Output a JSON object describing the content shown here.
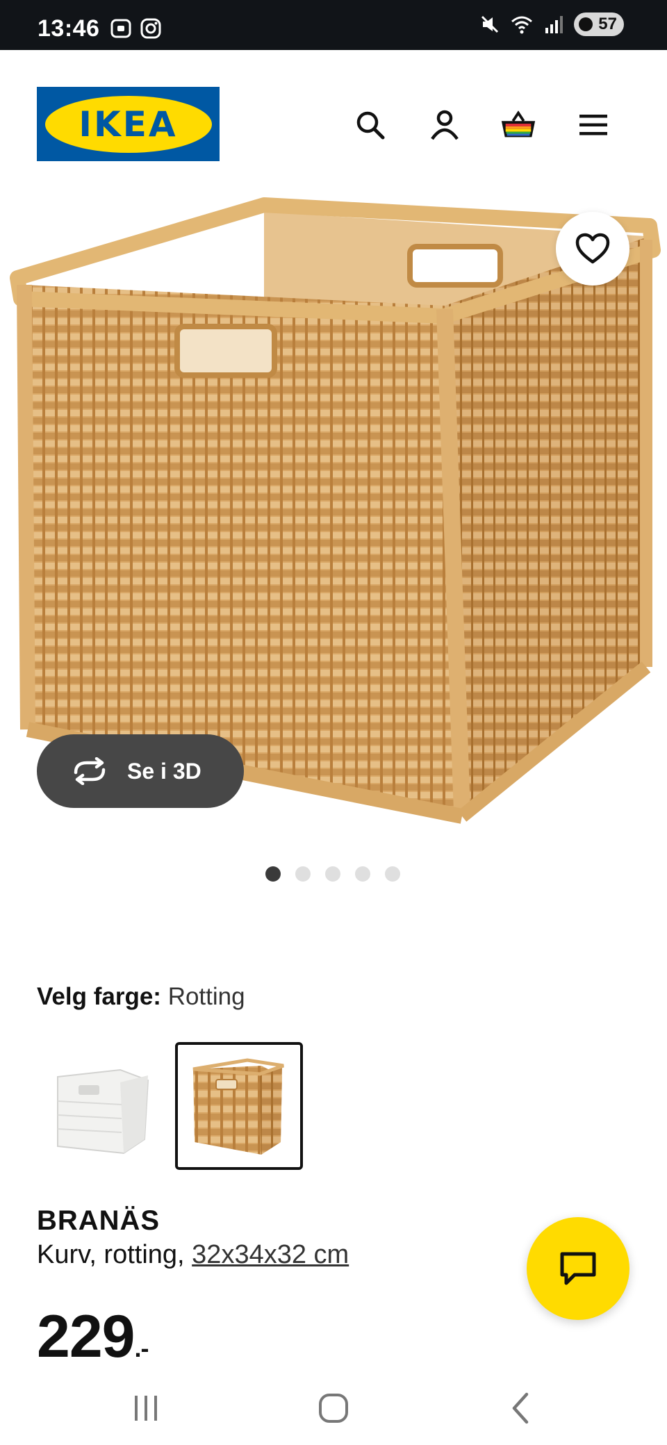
{
  "status_bar": {
    "time": "13:46",
    "battery": "57",
    "app_icons": [
      "screenshot-icon",
      "instagram-icon"
    ],
    "system_icons": [
      "mute-icon",
      "wifi-icon",
      "signal-icon"
    ]
  },
  "header": {
    "logo_text": "IKEA",
    "icons": [
      "search-icon",
      "account-icon",
      "basket-icon",
      "menu-icon"
    ],
    "brand_blue": "#0058a3",
    "brand_yellow": "#ffdb00"
  },
  "gallery": {
    "view_3d_label": "Se i 3D",
    "dot_count": 5,
    "active_dot": 0
  },
  "product": {
    "color_label": "Velg farge:",
    "color_value": "Rotting",
    "swatches": [
      "hvit",
      "rotting"
    ],
    "selected_swatch": 1,
    "name": "BRANÄS",
    "desc_prefix": "Kurv, rotting, ",
    "dims": "32x34x32 cm",
    "price_main": "229",
    "price_suffix": ".-"
  },
  "nav": {
    "items": [
      "recent-apps-icon",
      "home-icon",
      "back-icon"
    ]
  }
}
